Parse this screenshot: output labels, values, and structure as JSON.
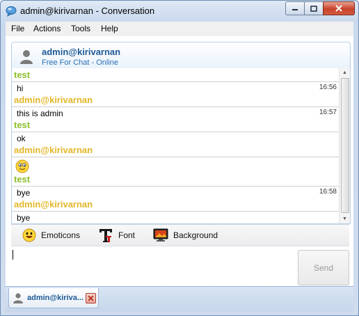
{
  "window": {
    "title": "admin@kirivarnan - Conversation"
  },
  "menu": {
    "items": [
      "File",
      "Actions",
      "Tools",
      "Help"
    ]
  },
  "contact": {
    "name": "admin@kirivarnan",
    "status": "Free For Chat - Online"
  },
  "messages": [
    {
      "sender": "test",
      "role": "them",
      "lines": [
        {
          "text": "hi",
          "time": "16:56"
        }
      ]
    },
    {
      "sender": "admin@kirivarnan",
      "role": "me",
      "lines": [
        {
          "text": "this is admin",
          "time": "16:57"
        }
      ]
    },
    {
      "sender": "test",
      "role": "them",
      "lines": [
        {
          "text": "ok",
          "time": ""
        }
      ]
    },
    {
      "sender": "admin@kirivarnan",
      "role": "me",
      "lines": [
        {
          "emoticon": "smiley-emoticon-icon",
          "time": ""
        }
      ]
    },
    {
      "sender": "test",
      "role": "them",
      "lines": [
        {
          "text": "bye",
          "time": "16:58"
        }
      ]
    },
    {
      "sender": "admin@kirivarnan",
      "role": "me",
      "lines": [
        {
          "text": "bye",
          "time": ""
        }
      ]
    }
  ],
  "toolbar": {
    "emoticons": "Emoticons",
    "font": "Font",
    "background": "Background"
  },
  "input": {
    "send_label": "Send"
  },
  "tabs": {
    "active_label": "admin@kiriva..."
  },
  "icons": {
    "app": "chat-bubble-icon",
    "avatar": "user-silhouette-icon",
    "emoticons": "smiley-icon",
    "font": "font-t-icon",
    "background": "monitor-icon",
    "tab_close": "close-x-icon"
  },
  "colors": {
    "sender_them": "#8cbe2c",
    "sender_me": "#e3b628",
    "contact_name": "#1e5a96"
  }
}
